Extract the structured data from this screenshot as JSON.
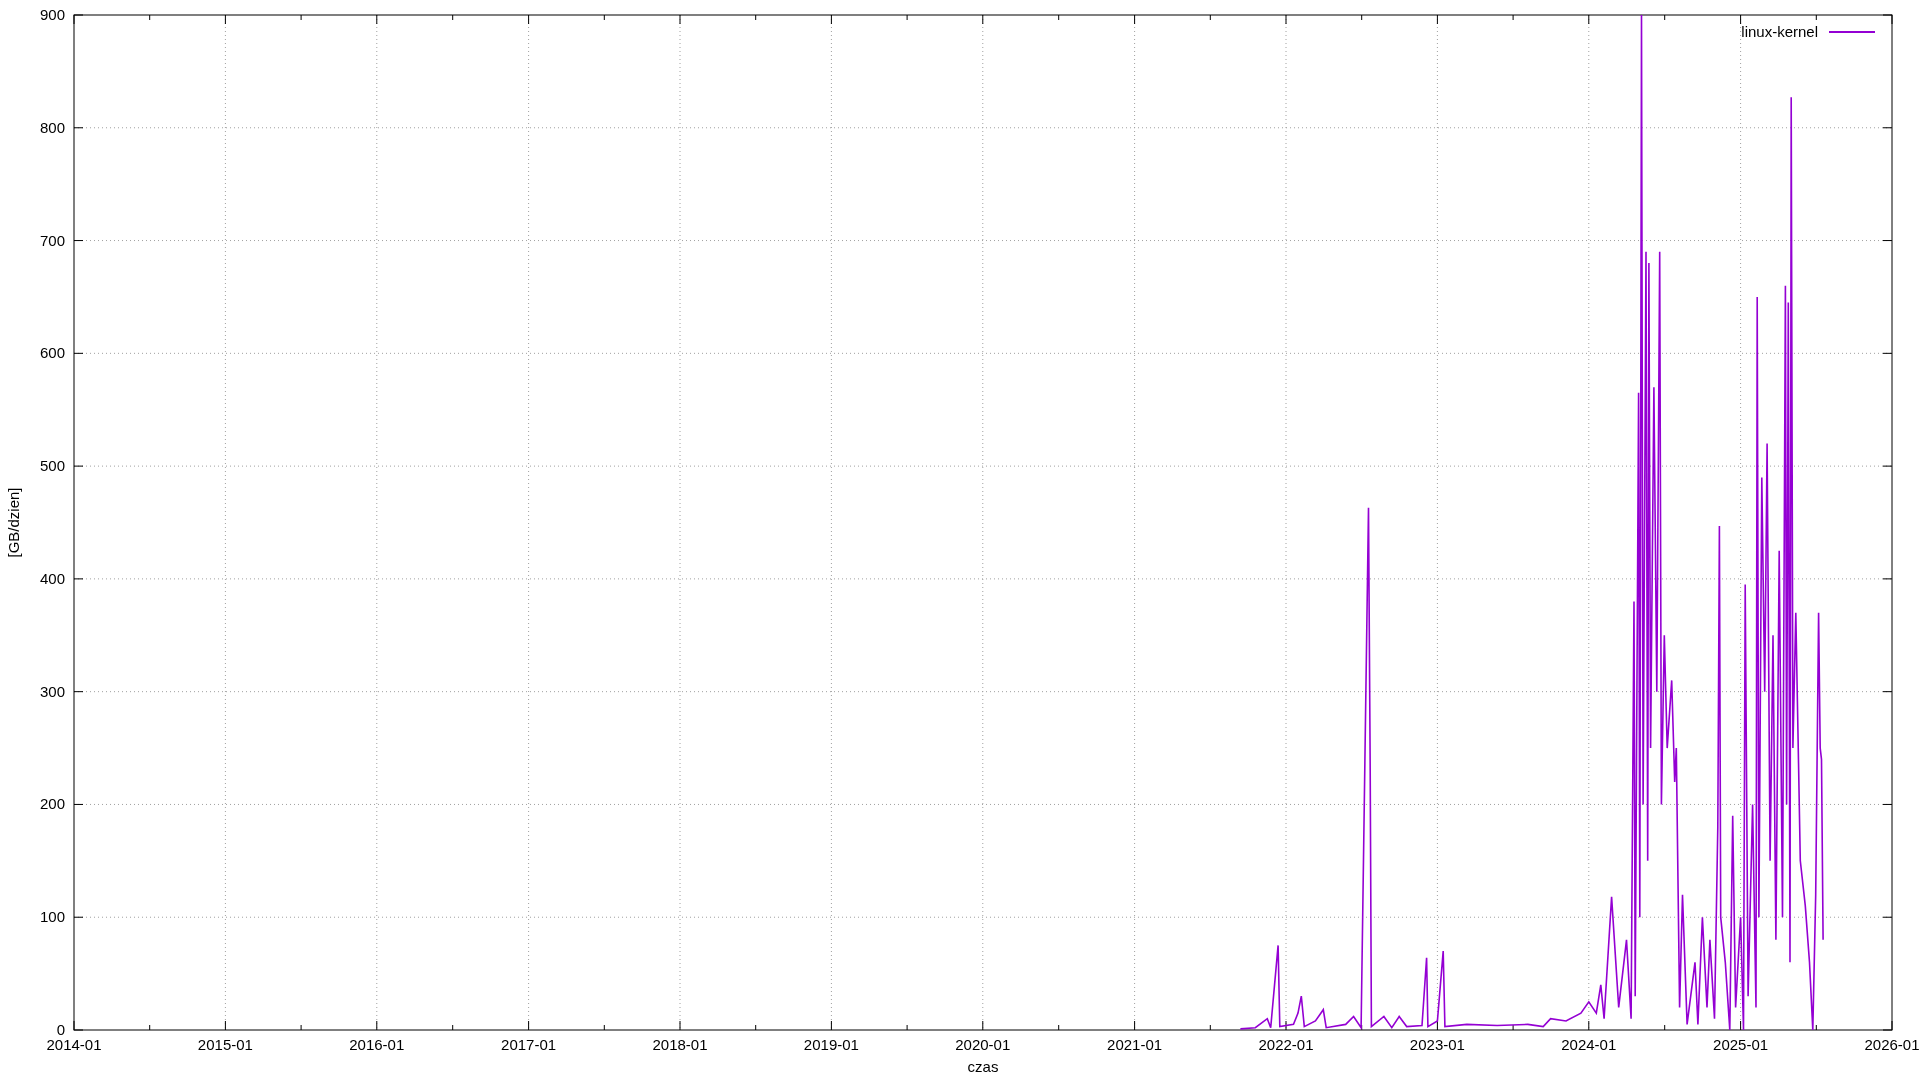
{
  "chart_data": {
    "type": "line",
    "grid": true,
    "xlabel": "czas",
    "ylabel": "[GB/dzien]",
    "xlim": [
      "2014-01-01",
      "2026-01-01"
    ],
    "ylim": [
      0,
      900
    ],
    "xticks": [
      {
        "value": "2014-01-01",
        "label": "2014-01"
      },
      {
        "value": "2015-01-01",
        "label": "2015-01"
      },
      {
        "value": "2016-01-01",
        "label": "2016-01"
      },
      {
        "value": "2017-01-01",
        "label": "2017-01"
      },
      {
        "value": "2018-01-01",
        "label": "2018-01"
      },
      {
        "value": "2019-01-01",
        "label": "2019-01"
      },
      {
        "value": "2020-01-01",
        "label": "2020-01"
      },
      {
        "value": "2021-01-01",
        "label": "2021-01"
      },
      {
        "value": "2022-01-01",
        "label": "2022-01"
      },
      {
        "value": "2023-01-01",
        "label": "2023-01"
      },
      {
        "value": "2024-01-01",
        "label": "2024-01"
      },
      {
        "value": "2025-01-01",
        "label": "2025-01"
      },
      {
        "value": "2026-01-01",
        "label": "2026-01"
      }
    ],
    "yticks": [
      0,
      100,
      200,
      300,
      400,
      500,
      600,
      700,
      800,
      900
    ],
    "x": [
      "2021-09-13",
      "2021-10-19",
      "2021-11-17",
      "2021-11-25",
      "2021-12-13",
      "2021-12-17",
      "2022-01-19",
      "2022-01-30",
      "2022-02-07",
      "2022-02-14",
      "2022-03-13",
      "2022-04-01",
      "2022-04-08",
      "2022-05-25",
      "2022-06-13",
      "2022-07-01",
      "2022-07-19",
      "2022-07-23",
      "2022-07-26",
      "2022-08-25",
      "2022-09-13",
      "2022-10-01",
      "2022-10-19",
      "2022-11-25",
      "2022-12-06",
      "2022-12-09",
      "2023-01-01",
      "2023-01-15",
      "2023-01-19",
      "2023-03-13",
      "2023-05-25",
      "2023-08-07",
      "2023-09-13",
      "2023-10-01",
      "2023-11-07",
      "2023-12-13",
      "2024-01-01",
      "2024-01-19",
      "2024-01-30",
      "2024-02-07",
      "2024-02-25",
      "2024-03-13",
      "2024-04-01",
      "2024-04-12",
      "2024-04-19",
      "2024-04-22",
      "2024-04-30",
      "2024-05-03",
      "2024-05-07",
      "2024-05-11",
      "2024-05-18",
      "2024-05-22",
      "2024-05-25",
      "2024-05-29",
      "2024-06-06",
      "2024-06-13",
      "2024-06-20",
      "2024-06-24",
      "2024-07-01",
      "2024-07-08",
      "2024-07-19",
      "2024-07-26",
      "2024-07-30",
      "2024-08-07",
      "2024-08-14",
      "2024-08-25",
      "2024-09-13",
      "2024-09-20",
      "2024-10-01",
      "2024-10-12",
      "2024-10-19",
      "2024-10-30",
      "2024-11-07",
      "2024-11-11",
      "2024-11-14",
      "2024-11-25",
      "2024-12-06",
      "2024-12-13",
      "2024-12-20",
      "2025-01-01",
      "2025-01-08",
      "2025-01-12",
      "2025-01-19",
      "2025-01-30",
      "2025-02-07",
      "2025-02-10",
      "2025-02-14",
      "2025-02-21",
      "2025-02-28",
      "2025-03-06",
      "2025-03-13",
      "2025-03-20",
      "2025-03-27",
      "2025-04-04",
      "2025-04-12",
      "2025-04-19",
      "2025-04-22",
      "2025-04-26",
      "2025-04-30",
      "2025-05-03",
      "2025-05-07",
      "2025-05-14",
      "2025-05-25",
      "2025-06-06",
      "2025-06-16",
      "2025-06-24",
      "2025-07-01",
      "2025-07-08",
      "2025-07-12",
      "2025-07-15",
      "2025-07-19"
    ],
    "series": [
      {
        "name": "linux-kernel",
        "color": "#9400d3",
        "values": [
          1,
          2,
          10,
          2,
          75,
          3,
          5,
          15,
          30,
          3,
          8,
          18,
          2,
          5,
          12,
          2,
          463,
          230,
          3,
          12,
          2,
          12,
          3,
          4,
          64,
          3,
          8,
          70,
          3,
          5,
          4,
          5,
          3,
          10,
          8,
          15,
          25,
          15,
          40,
          10,
          118,
          20,
          80,
          10,
          380,
          30,
          565,
          100,
          900,
          200,
          690,
          150,
          680,
          250,
          570,
          300,
          690,
          200,
          350,
          250,
          310,
          220,
          250,
          20,
          120,
          5,
          60,
          5,
          100,
          20,
          80,
          10,
          180,
          447,
          100,
          60,
          0,
          190,
          20,
          100,
          0,
          395,
          30,
          200,
          20,
          650,
          100,
          490,
          300,
          520,
          150,
          350,
          80,
          425,
          100,
          660,
          200,
          645,
          60,
          827,
          250,
          370,
          150,
          110,
          60,
          0,
          120,
          370,
          250,
          240,
          80
        ]
      }
    ]
  }
}
